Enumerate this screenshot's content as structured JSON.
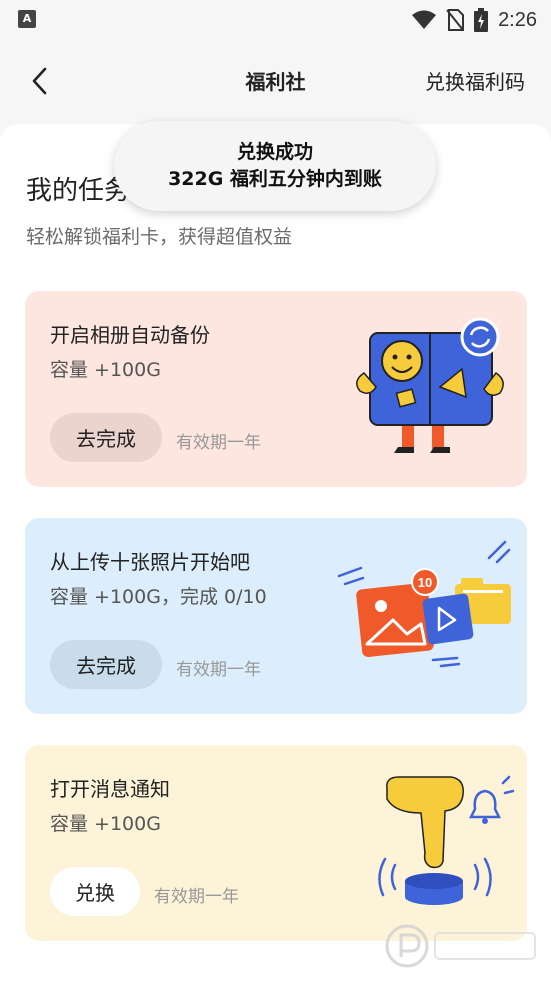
{
  "status_bar": {
    "time": "2:26"
  },
  "nav": {
    "title": "福利社",
    "right_link": "兑换福利码"
  },
  "header": {
    "title": "我的任务",
    "subtitle": "轻松解锁福利卡，获得超值权益"
  },
  "toast": {
    "line1": "兑换成功",
    "line2": "322G 福利五分钟内到账"
  },
  "tasks": [
    {
      "title": "开启相册自动备份",
      "reward": "容量 +100G",
      "button": "去完成",
      "validity": "有效期一年"
    },
    {
      "title": "从上传十张照片开始吧",
      "reward": "容量 +100G，完成 0/10",
      "button": "去完成",
      "validity": "有效期一年",
      "badge": "10"
    },
    {
      "title": "打开消息通知",
      "reward": "容量 +100G",
      "button": "兑换",
      "validity": "有效期一年"
    }
  ],
  "colors": {
    "card1": "#fde6df",
    "card2": "#dcedfb",
    "card3": "#fdf3d8",
    "accent_blue": "#3f63d8",
    "accent_yellow": "#f7cc3c",
    "accent_orange": "#f05a2a"
  },
  "icons": [
    "back-arrow-icon",
    "wifi-icon",
    "no-sim-icon",
    "battery-icon"
  ]
}
